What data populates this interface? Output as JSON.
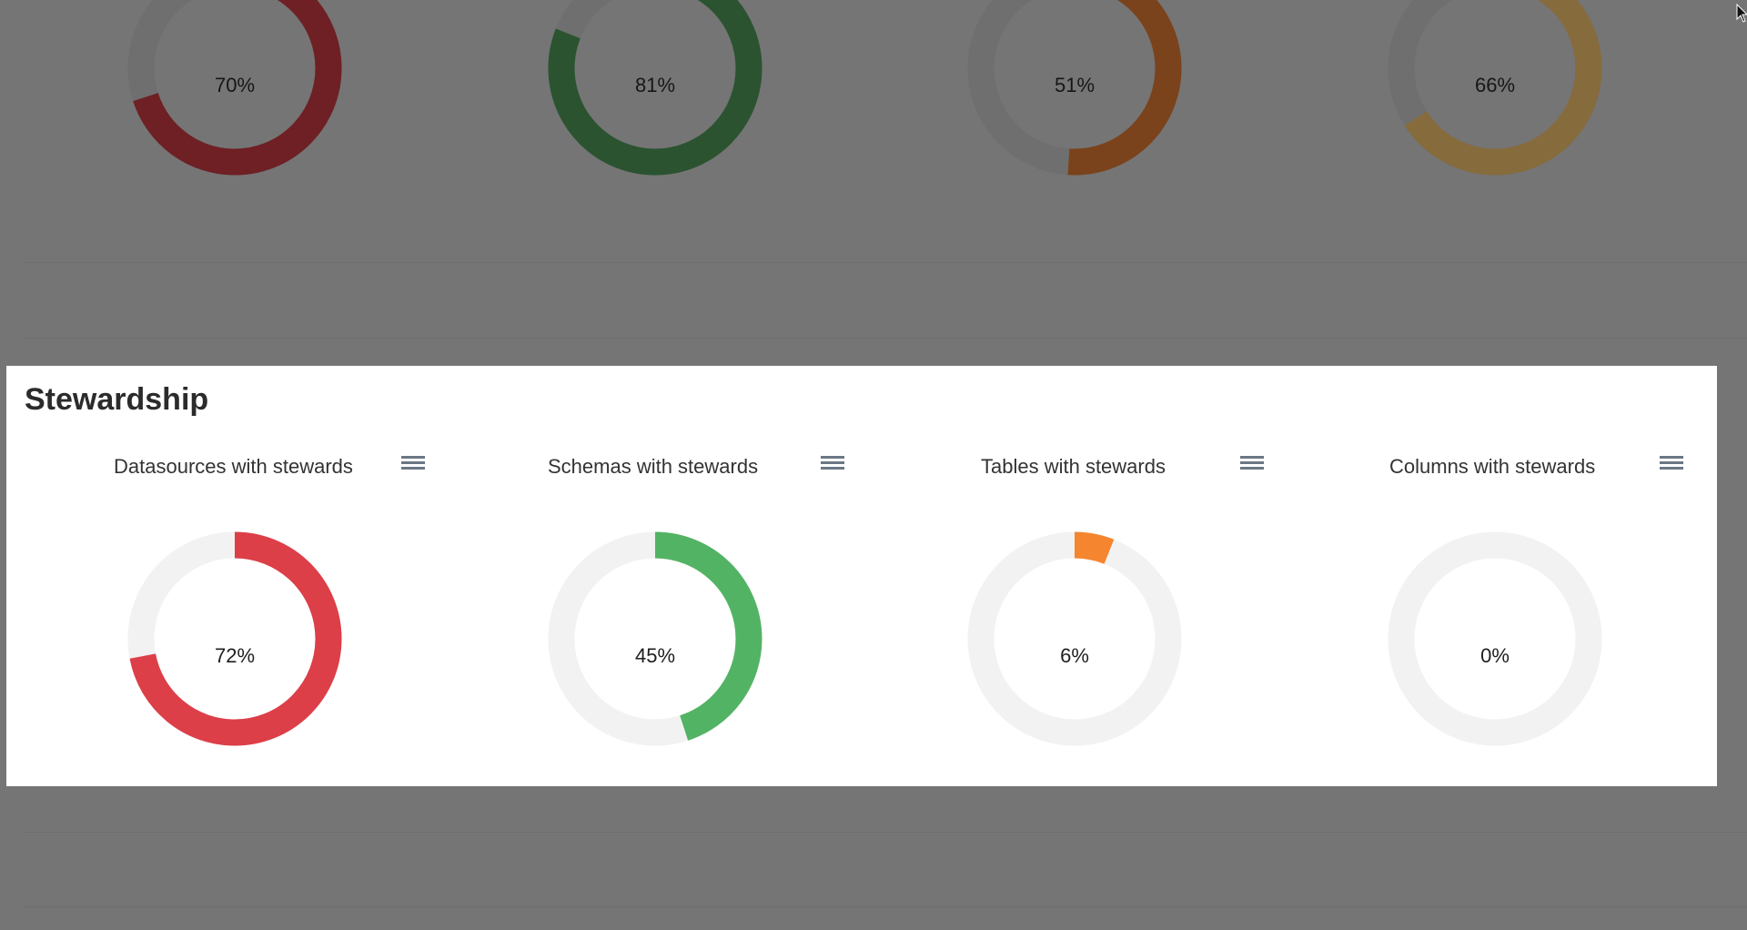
{
  "background": {
    "donuts": [
      {
        "label": "70%",
        "value": 70,
        "color": "#6e2024"
      },
      {
        "label": "81%",
        "value": 81,
        "color": "#2b5330"
      },
      {
        "label": "51%",
        "value": 51,
        "color": "#7a431c"
      },
      {
        "label": "66%",
        "value": 66,
        "color": "#866b3d"
      }
    ],
    "track_color": "#6f6f6f"
  },
  "stewardship": {
    "title": "Stewardship",
    "menu_icon": "hamburger-menu-icon",
    "track_color": "#f2f2f2",
    "cards": [
      {
        "title": "Datasources with stewards",
        "label": "72%",
        "value": 72,
        "color": "#dc3f48"
      },
      {
        "title": "Schemas with stewards",
        "label": "45%",
        "value": 45,
        "color": "#52b365"
      },
      {
        "title": "Tables with stewards",
        "label": "6%",
        "value": 6,
        "color": "#f5852f"
      },
      {
        "title": "Columns with stewards",
        "label": "0%",
        "value": 0,
        "color": "#f5852f"
      }
    ]
  }
}
